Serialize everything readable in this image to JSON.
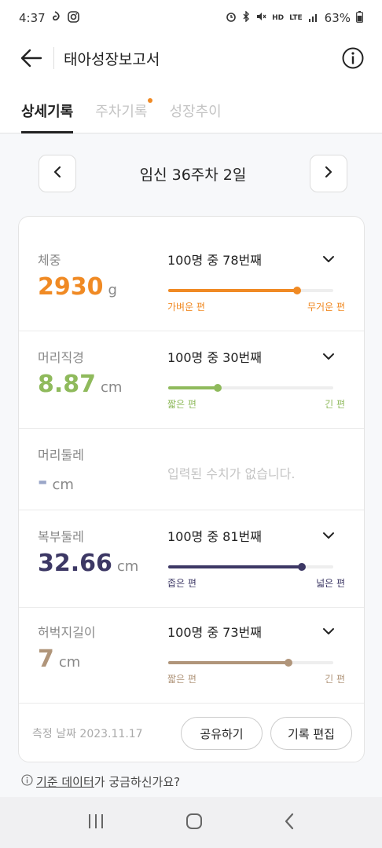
{
  "status": {
    "time": "4:37",
    "battery": "63%"
  },
  "header": {
    "title": "태아성장보고서"
  },
  "tabs": [
    {
      "label": "상세기록"
    },
    {
      "label": "주차기록"
    },
    {
      "label": "성장추이"
    }
  ],
  "week": {
    "label": "임신 36주차 2일"
  },
  "metrics": [
    {
      "label": "체중",
      "value": "2930",
      "unit": "g",
      "rank": "100명 중 78번째",
      "percentile": 0.78,
      "low": "가벼운 편",
      "high": "무거운 편",
      "color": "#f08a24"
    },
    {
      "label": "머리직경",
      "value": "8.87",
      "unit": "cm",
      "rank": "100명 중 30번째",
      "percentile": 0.3,
      "low": "짧은 편",
      "high": "긴 편",
      "color": "#8fba5c"
    },
    {
      "label": "머리둘레",
      "value": "-",
      "unit": "cm",
      "empty_msg": "입력된 수치가 없습니다.",
      "color": "#9aa6c8"
    },
    {
      "label": "복부둘레",
      "value": "32.66",
      "unit": "cm",
      "rank": "100명 중 81번째",
      "percentile": 0.81,
      "low": "좁은 편",
      "high": "넓은 편",
      "color": "#3d3865"
    },
    {
      "label": "허벅지길이",
      "value": "7",
      "unit": "cm",
      "rank": "100명 중 73번째",
      "percentile": 0.73,
      "low": "짧은 편",
      "high": "긴 편",
      "color": "#b0957a"
    }
  ],
  "footer": {
    "date": "측정 날짜 2023.11.17",
    "share_label": "공유하기",
    "edit_label": "기록 편집"
  },
  "help": {
    "link": "기준 데이터",
    "rest": "가 궁금하신가요?"
  }
}
